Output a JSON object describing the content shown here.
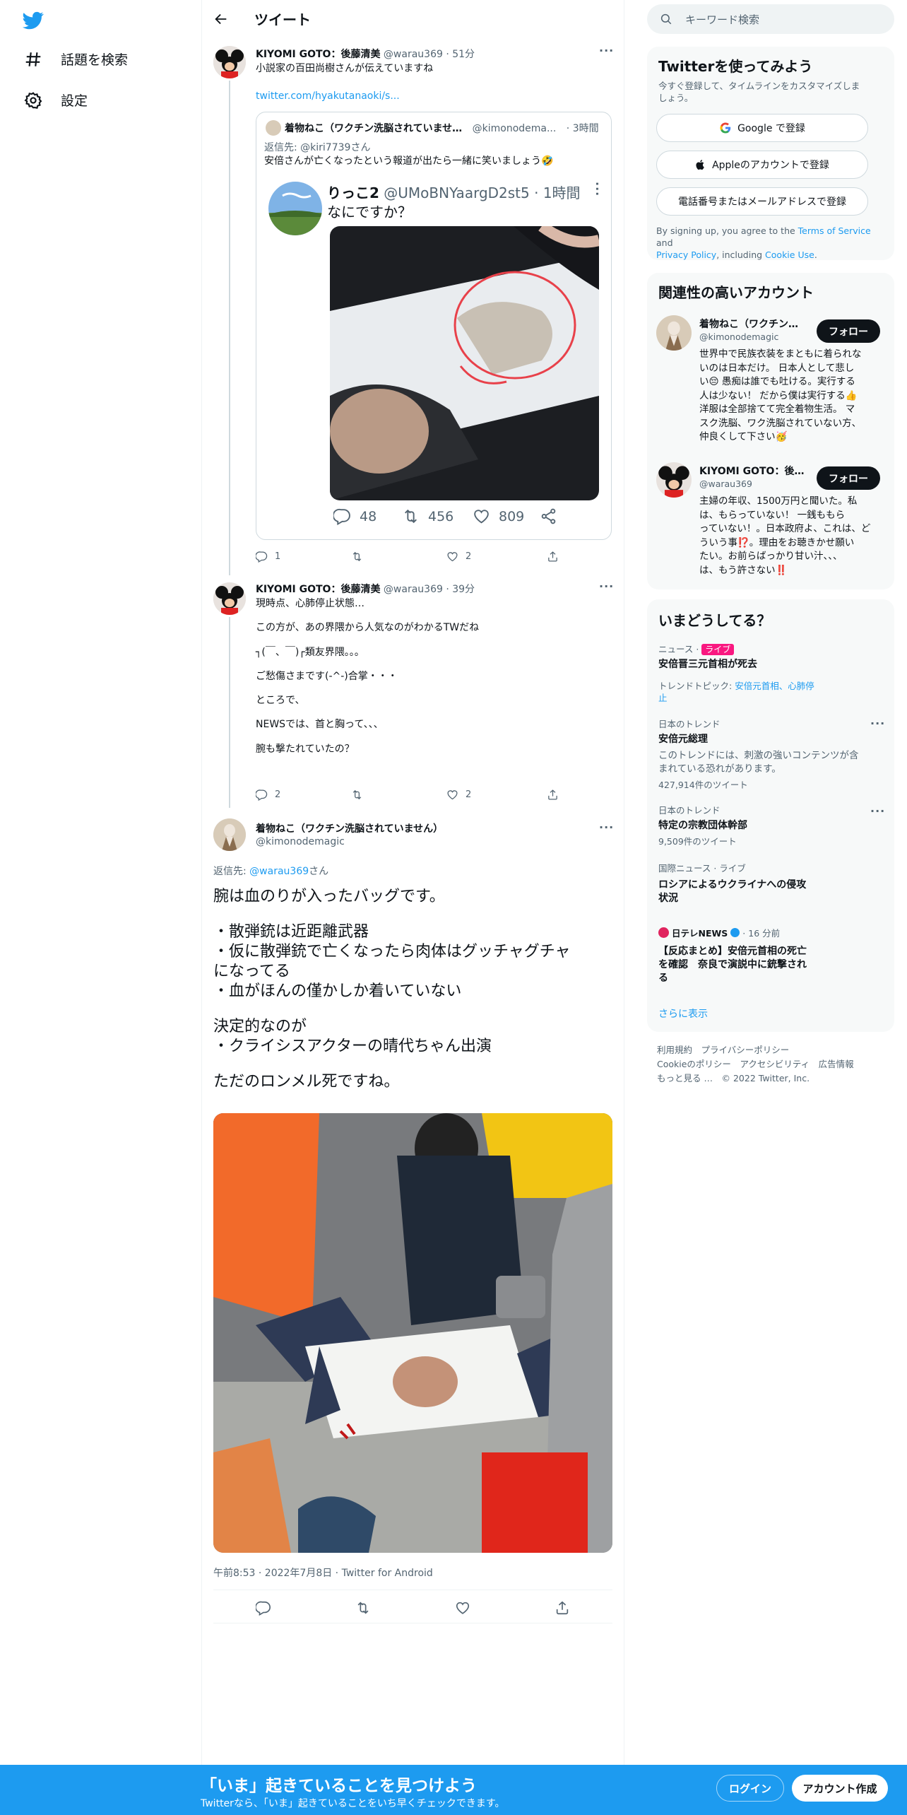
{
  "nav": {
    "explore": "話題を検索",
    "settings": "設定"
  },
  "header": {
    "title": "ツイート"
  },
  "tweet1": {
    "name": "KIYOMI GOTO：後藤清美",
    "handle": "@warau369",
    "time": "· 51分",
    "text": "小説家の百田尚樹さんが伝えていますね",
    "link": "twitter.com/hyakutanaoki/s...",
    "quote": {
      "name": "着物ねこ（ワクチン洗脳されていませ…",
      "handle": "@kimonodema...",
      "time": "· 3時間",
      "reply_to": "返信先: @kiri7739さん",
      "text": "安倍さんが亡くなったという報道が出たら一緒に笑いましょう🤣",
      "inner": {
        "name": "りっこ2",
        "handle": "@UMoBNYaargD2st5",
        "time": "· 1時間",
        "text": "なにですか？",
        "replies": "48",
        "retweets": "456",
        "likes": "809"
      }
    },
    "replies": "1",
    "retweets": "",
    "likes": "2"
  },
  "tweet2": {
    "name": "KIYOMI GOTO：後藤清美",
    "handle": "@warau369",
    "time": "· 39分",
    "lines": [
      "現時点、心肺停止状態…",
      "",
      "この方が、あの界隈から人気なのがわかるTWだね",
      "",
      "┐(￣、￣)┌類友界隈。。。",
      "",
      "ご愁傷さまです(-^-)合掌・・・",
      "",
      "ところで、",
      "",
      "NEWSでは、首と胸って、、、",
      "",
      "腕も撃たれていたの？"
    ],
    "replies": "2",
    "likes": "2"
  },
  "main": {
    "name": "着物ねこ（ワクチン洗脳されていません）",
    "handle": "@kimonodemagic",
    "reply_prefix": "返信先: ",
    "reply_handle": "@warau369",
    "reply_suffix": "さん",
    "lines": [
      "腕は血のりが入ったバッグです。",
      "",
      "・散弾銃は近距離武器",
      "・仮に散弾銃で亡くなったら肉体はグッチャグチャ",
      "になってる",
      "・血がほんの僅かしか着いていない",
      "",
      "決定的なのが",
      "・クライシスアクターの晴代ちゃん出演",
      "",
      "ただのロンメル死ですね。"
    ],
    "meta": "午前8:53 · 2022年7月8日 · Twitter for Android"
  },
  "right": {
    "search_placeholder": "キーワード検索",
    "signup": {
      "title": "Twitterを使ってみよう",
      "desc1": "今すぐ登録して、タイムラインをカスタマイズしま",
      "desc2": "しょう。",
      "google": "Google で登録",
      "apple": "Appleのアカウントで登録",
      "phone": "電話番号またはメールアドレスで登録",
      "terms1": "By signing up, you agree to the ",
      "terms_tos": "Terms of Service",
      "terms_and": " and",
      "terms_privacy": "Privacy Policy",
      "terms_incl": ", including ",
      "terms_cookie": "Cookie Use",
      "terms_end": "."
    },
    "related": {
      "title": "関連性の高いアカウント",
      "accounts": [
        {
          "name": "着物ねこ（ワクチン…",
          "handle": "@kimonodemagic",
          "follow": "フォロー",
          "bio": [
            "世界中で民族衣装をまともに着られな",
            "いのは日本だけ。 日本人として悲し",
            "い😔 愚痴は誰でも吐ける。実行する",
            "人は少ない！ だから僕は実行する👍",
            "洋服は全部捨てて完全着物生活。 マ",
            "スク洗脳、ワク洗脳されていない方、",
            "仲良くして下さい🥳"
          ]
        },
        {
          "name": "KIYOMI GOTO：後…",
          "handle": "@warau369",
          "follow": "フォロー",
          "bio": [
            "主婦の年収、1500万円と聞いた。私",
            "は、もらっていない！ 一銭ももら",
            "っていない！。日本政府よ、これは、ど",
            "ういう事⁉️。理由をお聴きかせ願い",
            "たい。お前らばっかり甘い汁、、、",
            "は、もう許さない‼️"
          ]
        }
      ]
    },
    "trends": {
      "title": "いまどうしてる？",
      "items": [
        {
          "meta": "ニュース · ",
          "badge": "ライブ",
          "name": "安倍晋三元首相が死去",
          "sub1": "トレンドトピック: ",
          "sub_link": "安倍元首相、心肺停",
          "sub_link2": "止"
        },
        {
          "meta": "日本のトレンド",
          "name": "安倍元総理",
          "sub": "このトレンドには、刺激の強いコンテンツが含",
          "sub2": "まれている恐れがあります。",
          "count": "427,914件のツイート"
        },
        {
          "meta": "日本のトレンド",
          "name": "特定の宗教団体幹部",
          "count": "9,509件のツイート"
        },
        {
          "meta": "国際ニュース · ライブ",
          "name": "ロシアによるウクライナへの侵攻",
          "name2": "状況"
        },
        {
          "meta_src": "日テレNEWS",
          "meta_time": "· 16 分前",
          "name": "【反応まとめ】安倍元首相の死亡",
          "name2": "を確認　奈良で演説中に銃撃され",
          "name3": "る"
        }
      ],
      "show_more": "さらに表示"
    },
    "footer": {
      "line1": [
        "利用規約",
        "プライバシーポリシー"
      ],
      "line2": [
        "Cookieのポリシー",
        "アクセシビリティ",
        "広告情報"
      ],
      "line3": [
        "もっと見る …",
        "© 2022 Twitter, Inc."
      ]
    }
  },
  "bottom": {
    "title": "「いま」起きていることを見つけよう",
    "sub": "Twitterなら、「いま」起きていることをいち早くチェックできます。",
    "login": "ログイン",
    "signup": "アカウント作成"
  }
}
